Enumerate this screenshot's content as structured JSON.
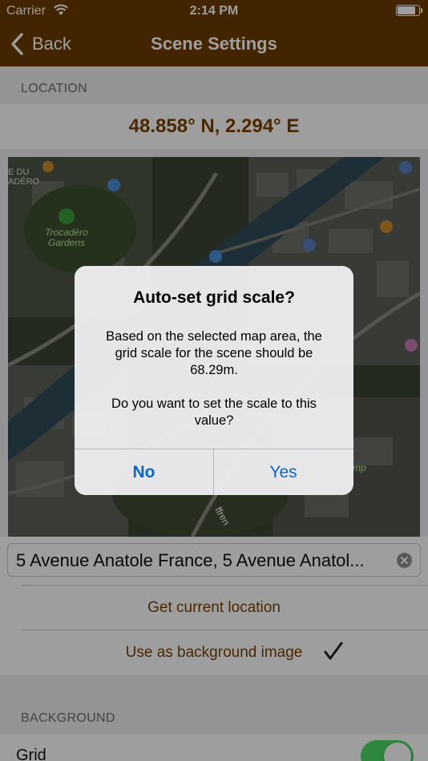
{
  "status_bar": {
    "carrier": "Carrier",
    "time": "2:14 PM"
  },
  "nav": {
    "back_label": "Back",
    "title": "Scene Settings"
  },
  "location_section": {
    "header": "LOCATION",
    "coordinates": "48.858° N, 2.294° E",
    "map_labels": {
      "trocadero": "Trocadéro\nGardens",
      "corner": "E DU\nADÉRO",
      "street": "ffren",
      "amp": "mp"
    },
    "address": "5 Avenue Anatole France, 5 Avenue Anatol...",
    "get_location_label": "Get current location",
    "use_background_label": "Use as background image",
    "use_background_checked": true
  },
  "background_section": {
    "header": "BACKGROUND",
    "grid_label": "Grid",
    "grid_enabled": true
  },
  "alert": {
    "title": "Auto-set grid scale?",
    "message_1": "Based on the selected map area, the grid scale for the scene should be 68.29m.",
    "message_2": "Do you want to set the scale to this value?",
    "no_label": "No",
    "yes_label": "Yes"
  }
}
